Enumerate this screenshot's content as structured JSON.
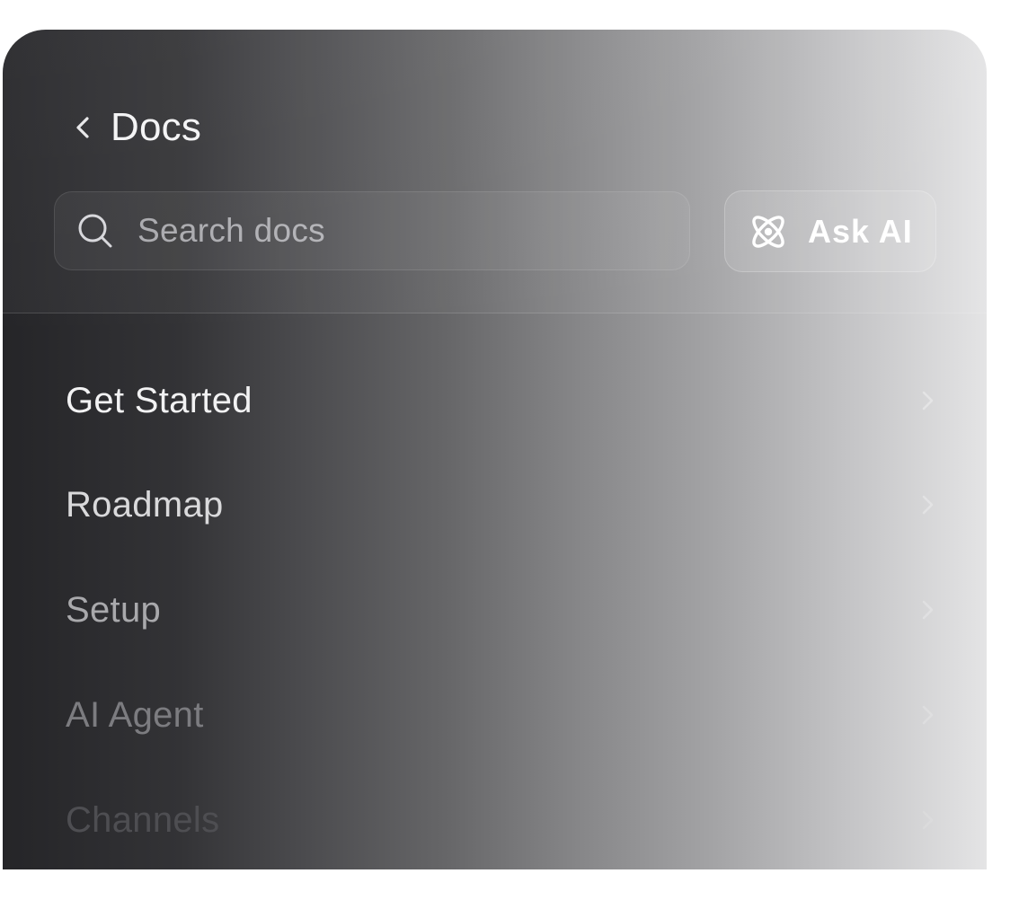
{
  "header": {
    "back_icon": "chevron-left-icon",
    "title": "Docs"
  },
  "search": {
    "icon": "search-icon",
    "placeholder": "Search docs"
  },
  "ask_ai": {
    "icon": "atom-icon",
    "label": "Ask AI"
  },
  "nav": {
    "items": [
      {
        "label": "Get Started",
        "color": "#f2f2f3",
        "chevron_icon": "chevron-right-icon"
      },
      {
        "label": "Roadmap",
        "color": "#d9d9db",
        "chevron_icon": "chevron-right-icon"
      },
      {
        "label": "Setup",
        "color": "#a9a9ac",
        "chevron_icon": "chevron-right-icon"
      },
      {
        "label": "AI Agent",
        "color": "#7c7c80",
        "chevron_icon": "chevron-right-icon"
      },
      {
        "label": "Channels",
        "color": "#4e4e52",
        "chevron_icon": "chevron-right-icon"
      }
    ]
  }
}
